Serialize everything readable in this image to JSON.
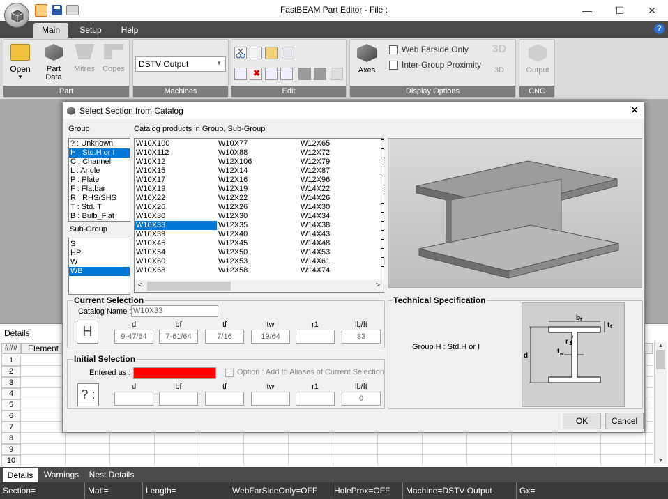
{
  "app": {
    "title": "FastBEAM Part Editor - File :"
  },
  "ribbon": {
    "tabs": [
      "Main",
      "Setup",
      "Help"
    ],
    "part_group": {
      "label": "Part",
      "open": "Open",
      "part_data_1": "Part",
      "part_data_2": "Data",
      "mitres": "Mitres",
      "copes": "Copes"
    },
    "machines_group": {
      "label": "Machines",
      "machine_value": "DSTV Output"
    },
    "edit_group": {
      "label": "Edit"
    },
    "display_group": {
      "label": "Display Options",
      "axes": "Axes",
      "web_farside": "Web Farside Only",
      "inter_group": "Inter-Group Proximity",
      "three_d_icon": "3D",
      "three_d": "3D"
    },
    "cnc_group": {
      "label": "CNC",
      "output": "Output"
    }
  },
  "details": {
    "title": "Details",
    "columns": [
      "###",
      "Element"
    ],
    "row_numbers": [
      "1",
      "2",
      "3",
      "4",
      "5",
      "6",
      "7",
      "8",
      "9",
      "10"
    ]
  },
  "bottom_tabs": [
    "Details",
    "Warnings",
    "Nest Details"
  ],
  "status": {
    "section": "Section=",
    "matl": "Matl=",
    "length": "Length=",
    "web": "WebFarSideOnly=OFF",
    "hole": "HoleProx=OFF",
    "machine": "Machine=DSTV Output",
    "gx": "Gx="
  },
  "dialog": {
    "title": "Select Section from Catalog",
    "group_label": "Group",
    "catalog_label": "Catalog products in Group, Sub-Group",
    "groups": [
      "? : Unknown",
      "H : Std.H or I",
      "C : Channel",
      "L : Angle",
      "P : Plate",
      "F : Flatbar",
      "R : RHS/SHS",
      "T : Std. T",
      "B : Bulb_Flat"
    ],
    "selected_group_index": 1,
    "subgroup_label": "Sub-Group",
    "subgroups": [
      "S",
      "HP",
      "W",
      "WB"
    ],
    "selected_subgroup_index": 3,
    "catalog_columns": [
      [
        "W10X100",
        "W10X112",
        "W10X12",
        "W10X15",
        "W10X17",
        "W10X19",
        "W10X22",
        "W10X26",
        "W10X30",
        "W10X33",
        "W10X39",
        "W10X45",
        "W10X54",
        "W10X60",
        "W10X68"
      ],
      [
        "W10X77",
        "W10X88",
        "W12X106",
        "W12X14",
        "W12X16",
        "W12X19",
        "W12X22",
        "W12X26",
        "W12X30",
        "W12X35",
        "W12X40",
        "W12X45",
        "W12X50",
        "W12X53",
        "W12X58"
      ],
      [
        "W12X65",
        "W12X72",
        "W12X79",
        "W12X87",
        "W12X96",
        "W14X22",
        "W14X26",
        "W14X30",
        "W14X34",
        "W14X38",
        "W14X43",
        "W14X48",
        "W14X53",
        "W14X61",
        "W14X74"
      ]
    ],
    "selected_catalog": "W10X33",
    "current": {
      "title": "Current Selection",
      "catalog_name_label": "Catalog Name :",
      "catalog_name": "W10X33",
      "symbol": "H",
      "fields": [
        {
          "label": "d",
          "value": "9-47/64"
        },
        {
          "label": "bf",
          "value": "7-61/64"
        },
        {
          "label": "tf",
          "value": "7/16"
        },
        {
          "label": "tw",
          "value": "19/64"
        },
        {
          "label": "r1",
          "value": ""
        },
        {
          "label": "lb/ft",
          "value": "33"
        }
      ]
    },
    "initial": {
      "title": "Initial Selection",
      "entered_as_label": "Entered as :",
      "option_label": "Option : Add to Aliases of Current Selection",
      "symbol": "? :",
      "fields": [
        {
          "label": "d",
          "value": ""
        },
        {
          "label": "bf",
          "value": ""
        },
        {
          "label": "tf",
          "value": ""
        },
        {
          "label": "tw",
          "value": ""
        },
        {
          "label": "r1",
          "value": ""
        },
        {
          "label": "lb/ft",
          "value": "0"
        }
      ]
    },
    "tech": {
      "title": "Technical Specification",
      "group_text": "Group H : Std.H or I",
      "bf": "b",
      "bf_sub": "f",
      "tf": "t",
      "tf_sub": "f",
      "r1": "r",
      "r1_sub": "1",
      "tw": "t",
      "tw_sub": "w",
      "d": "d"
    },
    "ok": "OK",
    "cancel": "Cancel"
  },
  "colors": {
    "selection": "#0078d7",
    "entered_as": "#ff0000",
    "ribbon_dark": "#4a4a4a"
  }
}
